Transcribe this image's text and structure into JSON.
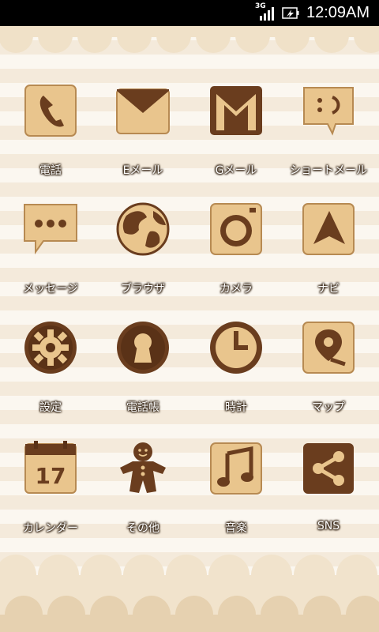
{
  "status_bar": {
    "network": "3G",
    "time": "12:09AM"
  },
  "apps": [
    {
      "label": "電話",
      "icon": "phone-icon"
    },
    {
      "label": "Eメール",
      "icon": "email-icon"
    },
    {
      "label": "Gメール",
      "icon": "gmail-icon"
    },
    {
      "label": "ショートメール",
      "icon": "sms-smile-icon"
    },
    {
      "label": "メッセージ",
      "icon": "message-bubble-icon"
    },
    {
      "label": "ブラウザ",
      "icon": "globe-icon"
    },
    {
      "label": "カメラ",
      "icon": "camera-icon"
    },
    {
      "label": "ナビ",
      "icon": "navigation-arrow-icon"
    },
    {
      "label": "設定",
      "icon": "gear-icon"
    },
    {
      "label": "電話帳",
      "icon": "contacts-keyhole-icon"
    },
    {
      "label": "時計",
      "icon": "clock-icon"
    },
    {
      "label": "マップ",
      "icon": "map-pin-icon"
    },
    {
      "label": "カレンダー",
      "icon": "calendar-icon",
      "calendar_day": "17"
    },
    {
      "label": "その他",
      "icon": "gingerbread-man-icon"
    },
    {
      "label": "音楽",
      "icon": "music-note-icon"
    },
    {
      "label": "SNS",
      "icon": "share-icon"
    }
  ],
  "colors": {
    "cookie_light": "#e9c58d",
    "cookie_dark": "#6a3d1e",
    "chocolate": "#5a3217"
  }
}
